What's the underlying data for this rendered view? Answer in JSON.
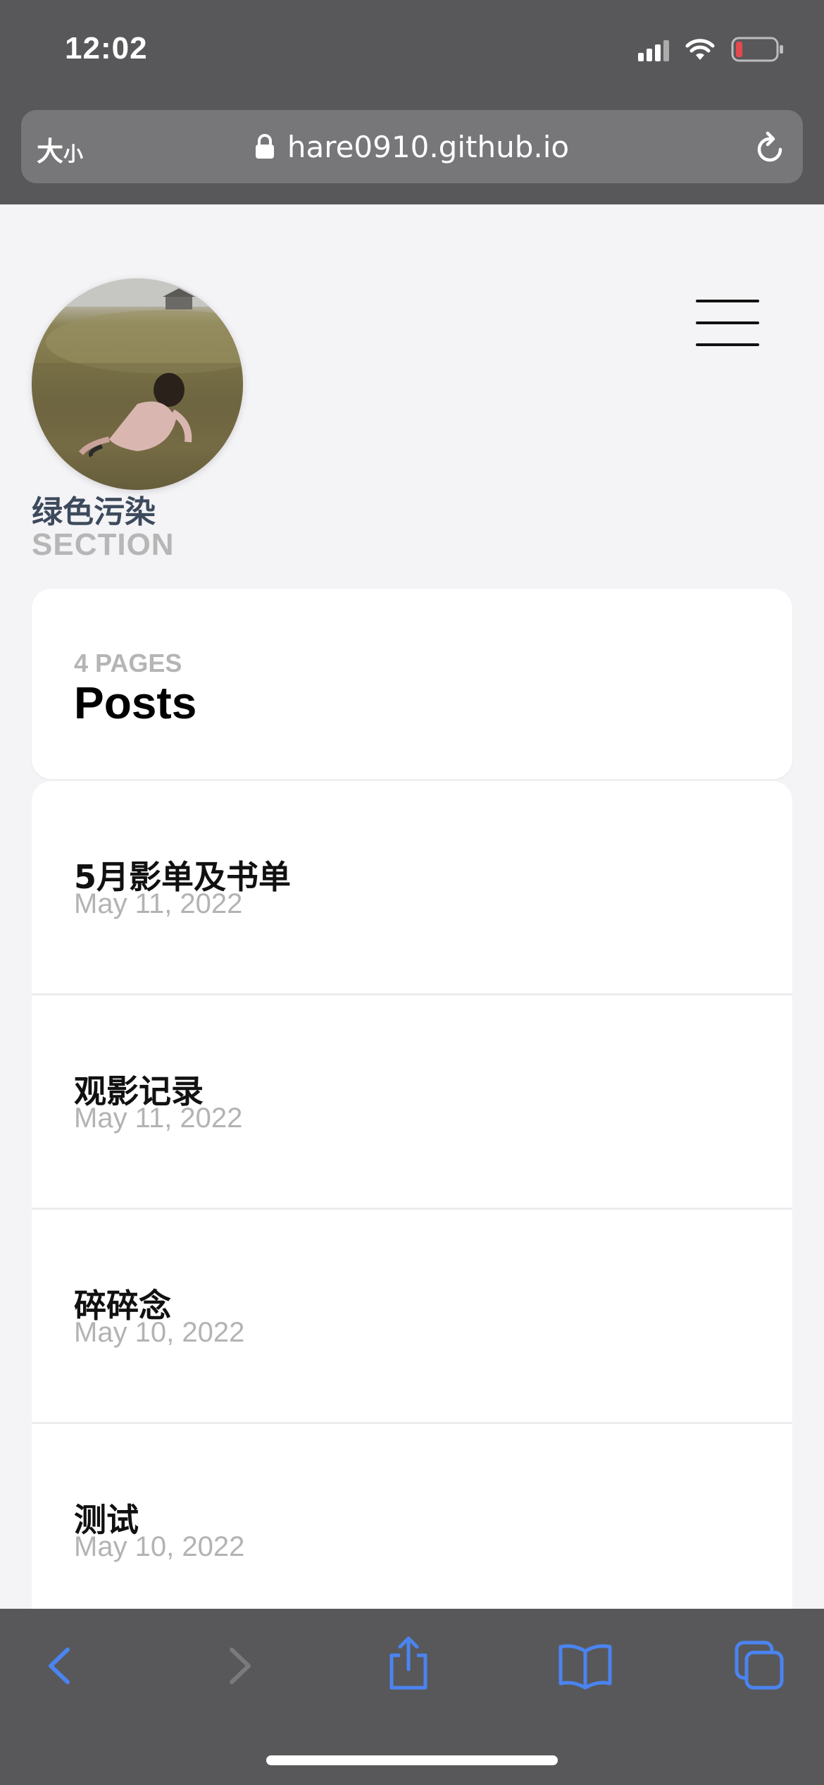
{
  "status_bar": {
    "time": "12:02",
    "icons": [
      "cellular-signal-icon",
      "wifi-icon",
      "battery-low-icon"
    ],
    "battery_color": "#e5484d"
  },
  "browser": {
    "text_size_label_big": "大",
    "text_size_label_small": "小",
    "url": "hare0910.github.io",
    "icons": [
      "lock-icon",
      "reload-icon"
    ]
  },
  "site": {
    "title": "绿色污染",
    "subtitle": "SECTION",
    "menu_icon": "hamburger-menu-icon"
  },
  "section": {
    "pages_count": "4 PAGES",
    "heading": "Posts"
  },
  "posts": [
    {
      "title": "5月影单及书单",
      "date": "May 11, 2022"
    },
    {
      "title": "观影记录",
      "date": "May 11, 2022"
    },
    {
      "title": "碎碎念",
      "date": "May 10, 2022"
    },
    {
      "title": "测试",
      "date": "May 10, 2022"
    }
  ],
  "toolbar": {
    "icons": [
      "back-icon",
      "forward-icon",
      "share-icon",
      "bookmarks-icon",
      "tabs-icon"
    ],
    "accent_color": "#4a84f0",
    "disabled_color": "#7a7a7e"
  }
}
